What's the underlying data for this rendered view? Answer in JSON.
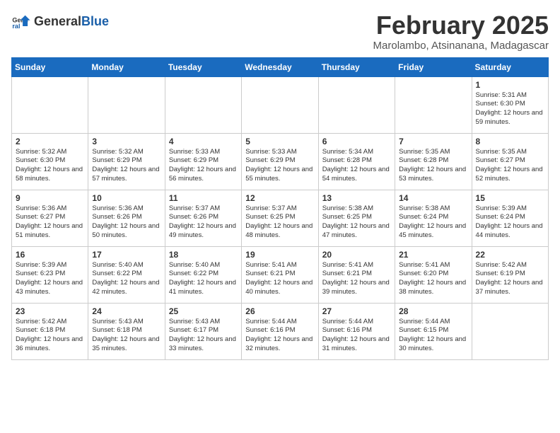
{
  "logo": {
    "general": "General",
    "blue": "Blue"
  },
  "title": "February 2025",
  "location": "Marolambo, Atsinanana, Madagascar",
  "weekdays": [
    "Sunday",
    "Monday",
    "Tuesday",
    "Wednesday",
    "Thursday",
    "Friday",
    "Saturday"
  ],
  "weeks": [
    [
      {
        "day": "",
        "info": ""
      },
      {
        "day": "",
        "info": ""
      },
      {
        "day": "",
        "info": ""
      },
      {
        "day": "",
        "info": ""
      },
      {
        "day": "",
        "info": ""
      },
      {
        "day": "",
        "info": ""
      },
      {
        "day": "1",
        "info": "Sunrise: 5:31 AM\nSunset: 6:30 PM\nDaylight: 12 hours and 59 minutes."
      }
    ],
    [
      {
        "day": "2",
        "info": "Sunrise: 5:32 AM\nSunset: 6:30 PM\nDaylight: 12 hours and 58 minutes."
      },
      {
        "day": "3",
        "info": "Sunrise: 5:32 AM\nSunset: 6:29 PM\nDaylight: 12 hours and 57 minutes."
      },
      {
        "day": "4",
        "info": "Sunrise: 5:33 AM\nSunset: 6:29 PM\nDaylight: 12 hours and 56 minutes."
      },
      {
        "day": "5",
        "info": "Sunrise: 5:33 AM\nSunset: 6:29 PM\nDaylight: 12 hours and 55 minutes."
      },
      {
        "day": "6",
        "info": "Sunrise: 5:34 AM\nSunset: 6:28 PM\nDaylight: 12 hours and 54 minutes."
      },
      {
        "day": "7",
        "info": "Sunrise: 5:35 AM\nSunset: 6:28 PM\nDaylight: 12 hours and 53 minutes."
      },
      {
        "day": "8",
        "info": "Sunrise: 5:35 AM\nSunset: 6:27 PM\nDaylight: 12 hours and 52 minutes."
      }
    ],
    [
      {
        "day": "9",
        "info": "Sunrise: 5:36 AM\nSunset: 6:27 PM\nDaylight: 12 hours and 51 minutes."
      },
      {
        "day": "10",
        "info": "Sunrise: 5:36 AM\nSunset: 6:26 PM\nDaylight: 12 hours and 50 minutes."
      },
      {
        "day": "11",
        "info": "Sunrise: 5:37 AM\nSunset: 6:26 PM\nDaylight: 12 hours and 49 minutes."
      },
      {
        "day": "12",
        "info": "Sunrise: 5:37 AM\nSunset: 6:25 PM\nDaylight: 12 hours and 48 minutes."
      },
      {
        "day": "13",
        "info": "Sunrise: 5:38 AM\nSunset: 6:25 PM\nDaylight: 12 hours and 47 minutes."
      },
      {
        "day": "14",
        "info": "Sunrise: 5:38 AM\nSunset: 6:24 PM\nDaylight: 12 hours and 45 minutes."
      },
      {
        "day": "15",
        "info": "Sunrise: 5:39 AM\nSunset: 6:24 PM\nDaylight: 12 hours and 44 minutes."
      }
    ],
    [
      {
        "day": "16",
        "info": "Sunrise: 5:39 AM\nSunset: 6:23 PM\nDaylight: 12 hours and 43 minutes."
      },
      {
        "day": "17",
        "info": "Sunrise: 5:40 AM\nSunset: 6:22 PM\nDaylight: 12 hours and 42 minutes."
      },
      {
        "day": "18",
        "info": "Sunrise: 5:40 AM\nSunset: 6:22 PM\nDaylight: 12 hours and 41 minutes."
      },
      {
        "day": "19",
        "info": "Sunrise: 5:41 AM\nSunset: 6:21 PM\nDaylight: 12 hours and 40 minutes."
      },
      {
        "day": "20",
        "info": "Sunrise: 5:41 AM\nSunset: 6:21 PM\nDaylight: 12 hours and 39 minutes."
      },
      {
        "day": "21",
        "info": "Sunrise: 5:41 AM\nSunset: 6:20 PM\nDaylight: 12 hours and 38 minutes."
      },
      {
        "day": "22",
        "info": "Sunrise: 5:42 AM\nSunset: 6:19 PM\nDaylight: 12 hours and 37 minutes."
      }
    ],
    [
      {
        "day": "23",
        "info": "Sunrise: 5:42 AM\nSunset: 6:18 PM\nDaylight: 12 hours and 36 minutes."
      },
      {
        "day": "24",
        "info": "Sunrise: 5:43 AM\nSunset: 6:18 PM\nDaylight: 12 hours and 35 minutes."
      },
      {
        "day": "25",
        "info": "Sunrise: 5:43 AM\nSunset: 6:17 PM\nDaylight: 12 hours and 33 minutes."
      },
      {
        "day": "26",
        "info": "Sunrise: 5:44 AM\nSunset: 6:16 PM\nDaylight: 12 hours and 32 minutes."
      },
      {
        "day": "27",
        "info": "Sunrise: 5:44 AM\nSunset: 6:16 PM\nDaylight: 12 hours and 31 minutes."
      },
      {
        "day": "28",
        "info": "Sunrise: 5:44 AM\nSunset: 6:15 PM\nDaylight: 12 hours and 30 minutes."
      },
      {
        "day": "",
        "info": ""
      }
    ]
  ]
}
